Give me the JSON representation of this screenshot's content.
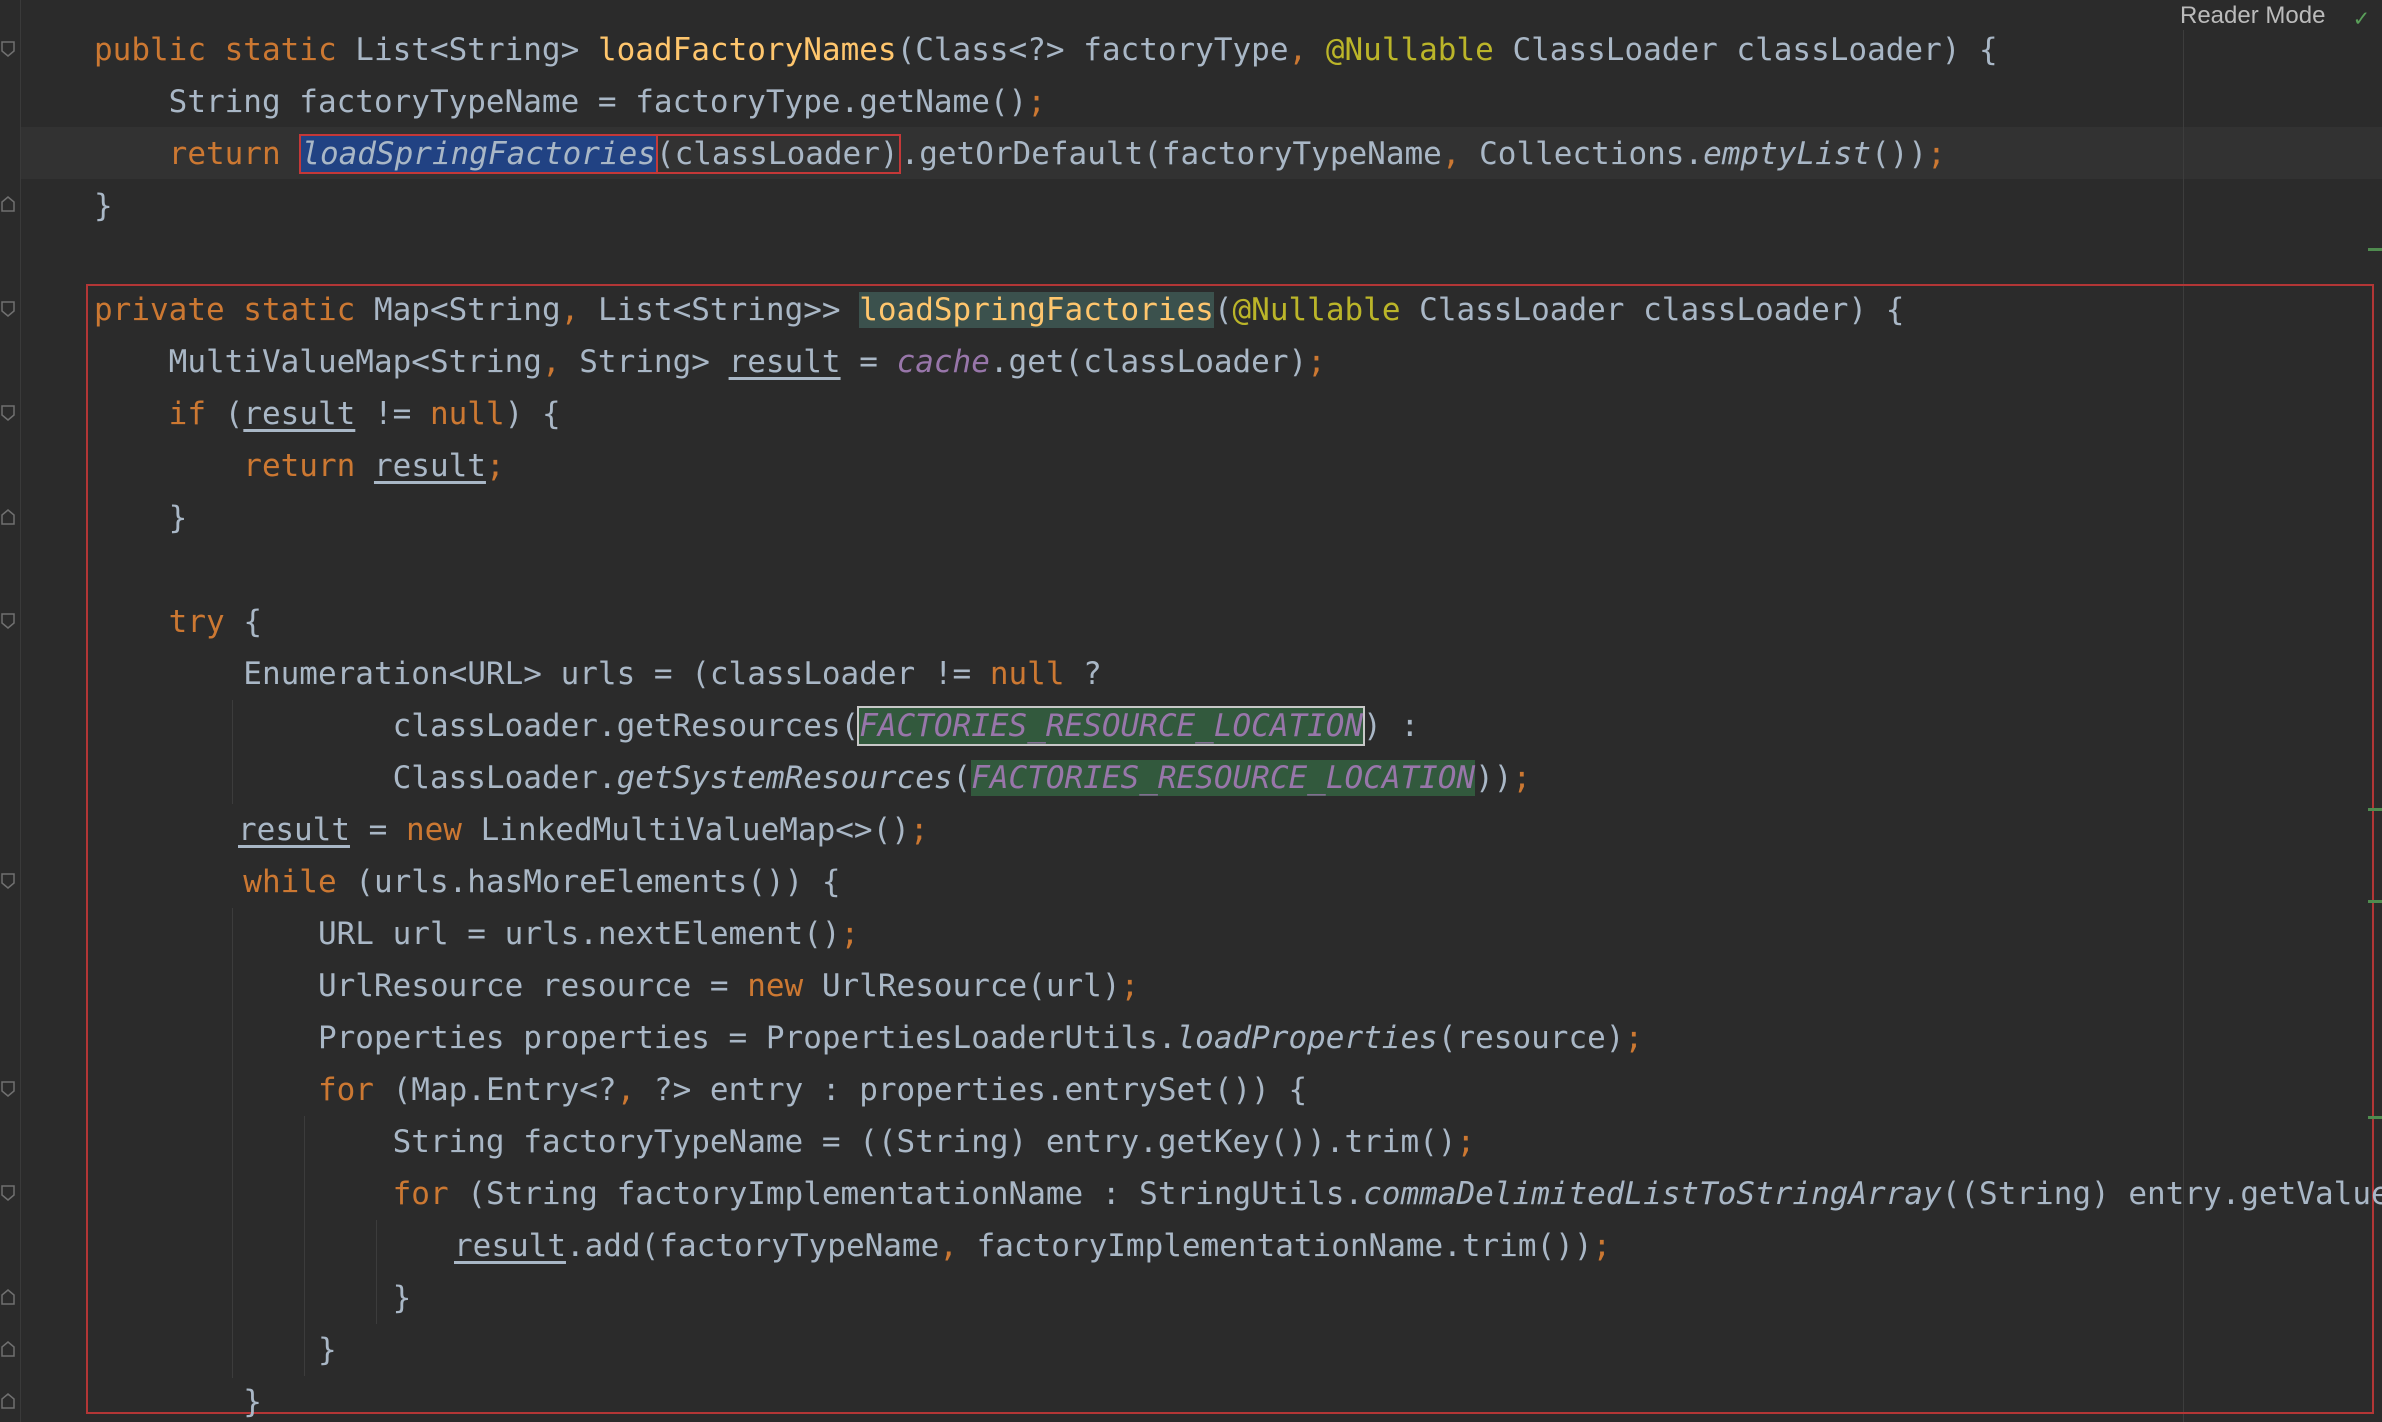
{
  "toolbar": {
    "reader_mode_label": "Reader Mode"
  },
  "colors": {
    "background": "#2b2b2b",
    "keyword": "#cc7832",
    "method": "#ffc66d",
    "annotation": "#bbb529",
    "field": "#9876aa",
    "default_text": "#a9b7c6",
    "selection": "#214283",
    "highlight_box": "#c43838",
    "usage_highlight": "#32593d"
  },
  "code": {
    "l1": {
      "a": "public static ",
      "b": "List<String> ",
      "c": "loadFactoryNames",
      "d": "(Class<?> factoryType",
      "e": ", ",
      "f": "@Nullable ",
      "g": "ClassLoader classLoader) {"
    },
    "l2": {
      "a": "    String factoryTypeName = factoryType.getName()",
      "b": ";"
    },
    "l3": {
      "a": "    return ",
      "b": "loadSpringFactories",
      "c": "(classLoader)",
      "d": ".getOrDefault(factoryTypeName",
      "e": ", ",
      "f": "Collections.",
      "g": "emptyList",
      "h": "())",
      "i": ";"
    },
    "l4": "}",
    "l5": {
      "a": "private static ",
      "b": "Map<String",
      "c": ", ",
      "d": "List<String>> ",
      "e": "loadSpringFactories",
      "f": "(",
      "g": "@Nullable ",
      "h": "ClassLoader classLoader) {"
    },
    "l6": {
      "a": "    MultiValueMap<String",
      "b": ", ",
      "c": "String> ",
      "d": "result",
      "e": " = ",
      "f": "cache",
      "g": ".get(classLoader)",
      "h": ";"
    },
    "l7": {
      "a": "    if ",
      "b": "(",
      "c": "result",
      "d": " != ",
      "e": "null",
      "f": ") {"
    },
    "l8": {
      "a": "        return ",
      "b": "result",
      "c": ";"
    },
    "l9": "    }",
    "l10": {
      "a": "    try ",
      "b": "{"
    },
    "l11": {
      "a": "        Enumeration<URL> urls = (classLoader != ",
      "b": "null",
      "c": " ?"
    },
    "l12": {
      "a": "                classLoader.getResources(",
      "b": "FACTORIES_RESOURCE_LOCATION",
      "c": ") :"
    },
    "l13": {
      "a": "                ClassLoader.",
      "b": "getSystemResources",
      "c": "(",
      "d": "FACTORIES_RESOURCE_LOCATION",
      "e": "))",
      "f": ";"
    },
    "l14": {
      "a": "result",
      "b": " = ",
      "c": "new ",
      "d": "LinkedMultiValueMap<>()",
      "e": ";"
    },
    "l15": {
      "a": "        while ",
      "b": "(urls.hasMoreElements()) {"
    },
    "l16": {
      "a": "            URL url = urls.nextElement()",
      "b": ";"
    },
    "l17": {
      "a": "            UrlResource resource = ",
      "b": "new ",
      "c": "UrlResource(url)",
      "d": ";"
    },
    "l18": {
      "a": "            Properties properties = PropertiesLoaderUtils.",
      "b": "loadProperties",
      "c": "(resource)",
      "d": ";"
    },
    "l19": {
      "a": "            for ",
      "b": "(Map.Entry<?",
      "c": ", ",
      "d": "?> entry : properties.entrySet()) {"
    },
    "l20": {
      "a": "                String factoryTypeName = ((String) entry.getKey()).trim()",
      "b": ";"
    },
    "l21": {
      "a": "                for ",
      "b": "(String factoryImplementationName : StringUtils.",
      "c": "commaDelimitedListToStringArray",
      "d": "((String) entry.getValue()))"
    },
    "l22": {
      "a": "result",
      "b": ".add(factoryTypeName",
      "c": ", ",
      "d": "factoryImplementationName.trim())",
      "e": ";"
    },
    "l23": "                }",
    "l24": "            }",
    "l25": "        }"
  }
}
